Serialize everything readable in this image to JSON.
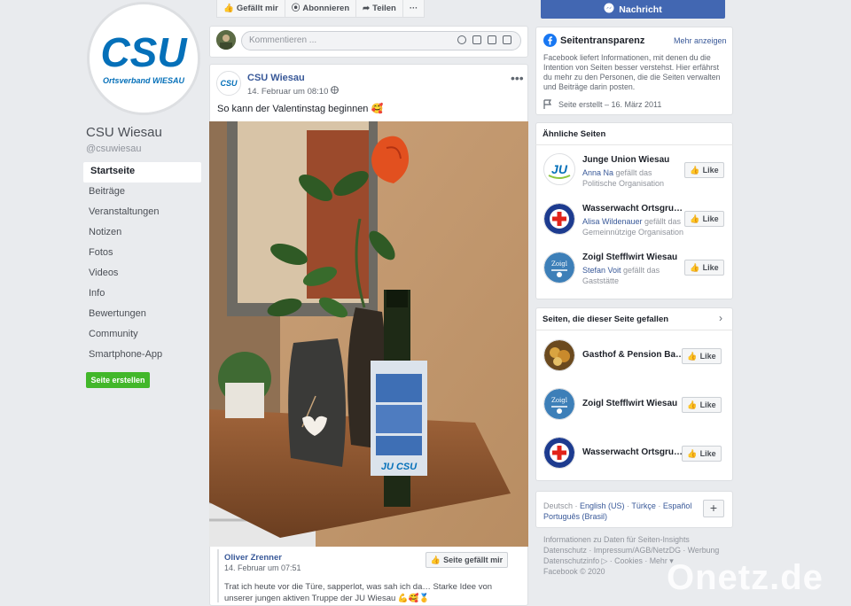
{
  "page": {
    "name": "CSU Wiesau",
    "handle": "@csuwiesau",
    "logo_text": "CSU",
    "logo_sub": "Ortsverband WIESAU"
  },
  "nav": [
    "Startseite",
    "Beiträge",
    "Veranstaltungen",
    "Notizen",
    "Fotos",
    "Videos",
    "Info",
    "Bewertungen",
    "Community",
    "Smartphone-App"
  ],
  "create_page_label": "Seite erstellen",
  "top_actions": {
    "liked": "Gefällt mir",
    "subscribed": "Abonnieren",
    "share": "Teilen",
    "more": "···"
  },
  "message_button": "Nachricht",
  "comment_placeholder": "Kommentieren ...",
  "post": {
    "author": "CSU Wiesau",
    "time": "14. Februar um 08:10",
    "text": "So kann der Valentinstag beginnen 🥰",
    "shared_author": "Oliver Zrenner",
    "shared_time": "14. Februar um 07:51",
    "shared_like": "Seite gefällt mir",
    "shared_text": "Trat ich heute vor die Türe, sapperlot, was sah ich da… Starke Idee von unserer jungen aktiven Truppe der JU Wiesau 💪🥰🥇",
    "bottle_label": "JU CSU"
  },
  "transparency": {
    "title": "Seitentransparenz",
    "more": "Mehr anzeigen",
    "text": "Facebook liefert Informationen, mit denen du die Intention von Seiten besser verstehst. Hier erfährst du mehr zu den Personen, die die Seiten verwalten und Beiträge darin posten.",
    "created": "Seite erstellt – 16. März 2011"
  },
  "similar": {
    "heading": "Ähnliche Seiten",
    "like_label": "Like",
    "items": [
      {
        "name": "Junge Union Wiesau",
        "person": "Anna Na",
        "rest": " gefällt das",
        "cat": "Politische Organisation",
        "logo": "JU"
      },
      {
        "name": "Wasserwacht Ortsgrup…",
        "person": "Alisa Wildenauer",
        "rest": " gefällt das",
        "cat": "Gemeinnützige Organisation",
        "logo": "cross"
      },
      {
        "name": "Zoigl Stefflwirt Wiesau",
        "person": "Stefan Voit",
        "rest": " gefällt das",
        "cat": "Gaststätte",
        "logo": "Zoigl"
      }
    ]
  },
  "liked": {
    "heading": "Seiten, die dieser Seite gefallen",
    "like_label": "Like",
    "items": [
      {
        "name": "Gasthof & Pension Ba…",
        "logo": "food"
      },
      {
        "name": "Zoigl Stefflwirt Wiesau",
        "logo": "Zoigl"
      },
      {
        "name": "Wasserwacht Ortsgru…",
        "logo": "cross"
      }
    ]
  },
  "languages": {
    "current": "Deutsch",
    "others": [
      "English (US)",
      "Türkçe",
      "Español",
      "Português (Brasil)"
    ]
  },
  "footer": {
    "line1": "Informationen zu Daten für Seiten-Insights",
    "line2": "Datenschutz · Impressum/AGB/NetzDG · Werbung",
    "line3": "Datenschutzinfo ▷ · Cookies · Mehr ▾",
    "copyright": "Facebook © 2020"
  },
  "watermark": "Onetz.de",
  "colors": {
    "brand": "#4267b2",
    "csu_blue": "#0570b9",
    "green": "#42b72a",
    "link": "#385898"
  }
}
